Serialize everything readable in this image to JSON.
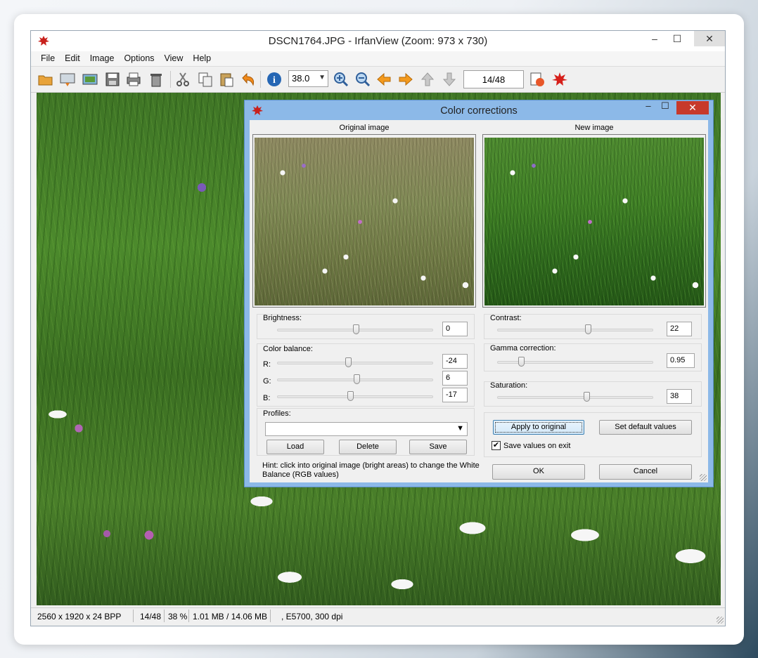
{
  "window": {
    "title": "DSCN1764.JPG - IrfanView (Zoom: 973 x 730)",
    "controls": {
      "minimize": "–",
      "maximize": "☐",
      "close": "✕"
    }
  },
  "menu": [
    "File",
    "Edit",
    "Image",
    "Options",
    "View",
    "Help"
  ],
  "toolbar": {
    "icons": [
      "open-icon",
      "thumbnails-icon",
      "slideshow-icon",
      "save-icon",
      "print-icon",
      "delete-icon",
      "cut-icon",
      "copy-icon",
      "paste-icon",
      "undo-icon",
      "info-icon",
      "zoom-in-icon",
      "zoom-out-icon",
      "prev-icon",
      "next-icon",
      "first-icon",
      "last-icon",
      "auto-adjust-icon",
      "irfanview-logo-icon"
    ],
    "zoom_value": "38.0",
    "page_counter": "14/48"
  },
  "statusbar": {
    "dimensions": "2560 x 1920 x 24 BPP",
    "index": "14/48",
    "zoom": "38 %",
    "size": "1.01 MB / 14.06 MB",
    "exif": ", E5700, 300 dpi"
  },
  "dialog": {
    "title": "Color corrections",
    "controls": {
      "minimize": "–",
      "maximize": "☐",
      "close": "✕"
    },
    "original_label": "Original image",
    "new_label": "New image",
    "brightness": {
      "label": "Brightness:",
      "value": "0",
      "level": 0
    },
    "color_balance": {
      "label": "Color balance:",
      "r": {
        "label": "R:",
        "value": "-24"
      },
      "g": {
        "label": "G:",
        "value": "6"
      },
      "b": {
        "label": "B:",
        "value": "-17"
      }
    },
    "contrast": {
      "label": "Contrast:",
      "value": "22"
    },
    "gamma": {
      "label": "Gamma correction:",
      "value": "0.95"
    },
    "saturation": {
      "label": "Saturation:",
      "value": "38"
    },
    "profiles": {
      "label": "Profiles:",
      "selected": "",
      "load": "Load",
      "delete": "Delete",
      "save": "Save"
    },
    "apply_original": "Apply to original",
    "set_default": "Set default values",
    "save_values_checkbox": {
      "label": "Save values on exit",
      "checked": true,
      "mark": "✔"
    },
    "ok": "OK",
    "cancel": "Cancel",
    "hint": "Hint: click into original image (bright areas) to change the White Balance (RGB values)"
  }
}
